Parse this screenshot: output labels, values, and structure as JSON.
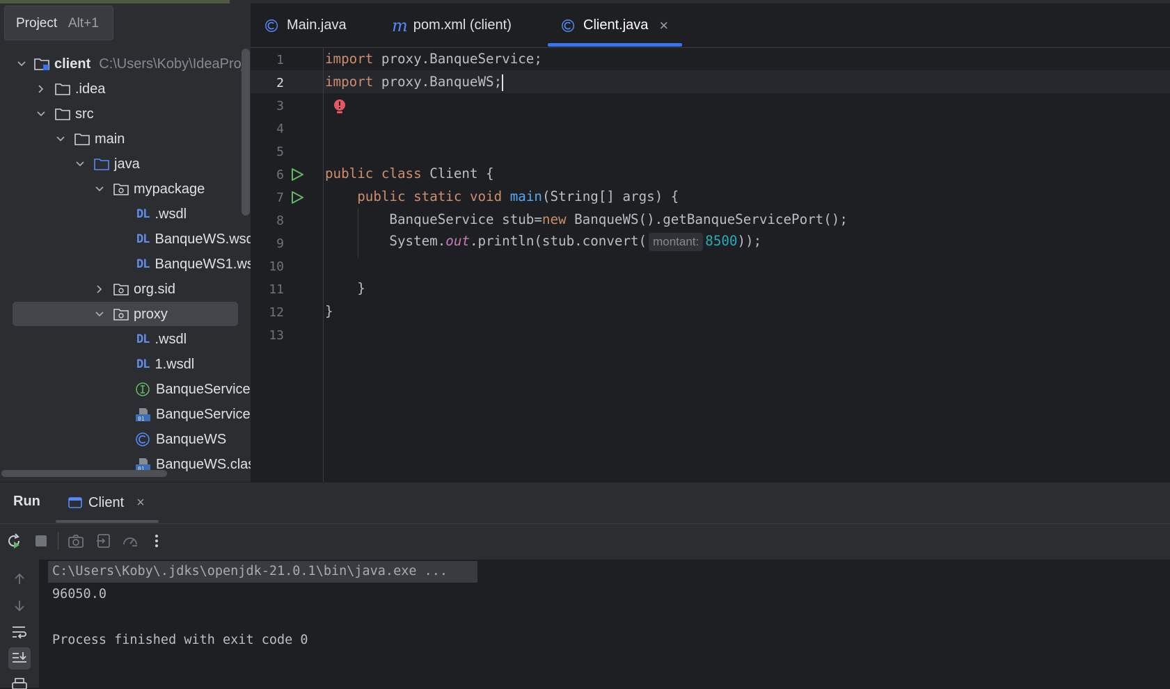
{
  "project_panel": {
    "title": "Project",
    "shortcut": "Alt+1",
    "tree": [
      {
        "label": "client",
        "path": "C:\\Users\\Koby\\IdeaProj",
        "type": "module",
        "chevron": "down"
      },
      {
        "label": ".idea",
        "type": "folder",
        "chevron": "right"
      },
      {
        "label": "src",
        "type": "folder",
        "chevron": "down"
      },
      {
        "label": "main",
        "type": "folder",
        "chevron": "down"
      },
      {
        "label": "java",
        "type": "source-folder",
        "chevron": "down"
      },
      {
        "label": "mypackage",
        "type": "package",
        "chevron": "down"
      },
      {
        "label": ".wsdl",
        "type": "wsdl"
      },
      {
        "label": "BanqueWS.wsd",
        "type": "wsdl"
      },
      {
        "label": "BanqueWS1.ws",
        "type": "wsdl"
      },
      {
        "label": "org.sid",
        "type": "package",
        "chevron": "right"
      },
      {
        "label": "proxy",
        "type": "package",
        "chevron": "down",
        "selected": true
      },
      {
        "label": ".wsdl",
        "type": "wsdl"
      },
      {
        "label": "1.wsdl",
        "type": "wsdl"
      },
      {
        "label": "BanqueService",
        "type": "interface"
      },
      {
        "label": "BanqueService",
        "type": "classfile"
      },
      {
        "label": "BanqueWS",
        "type": "class"
      },
      {
        "label": "BanqueWS.clas",
        "type": "classfile"
      }
    ]
  },
  "editor_tabs": [
    {
      "label": "Main.java",
      "icon": "class-icon",
      "active": false
    },
    {
      "label": "pom.xml (client)",
      "icon": "maven-icon",
      "active": false
    },
    {
      "label": "Client.java",
      "icon": "class-icon",
      "active": true,
      "close": "×"
    }
  ],
  "code": {
    "line_numbers": [
      "1",
      "2",
      "3",
      "4",
      "5",
      "6",
      "7",
      "8",
      "9",
      "10",
      "11",
      "12",
      "13"
    ],
    "current_line": "2",
    "l1": {
      "kw": "import",
      "rest": " proxy.BanqueService;"
    },
    "l2": {
      "kw": "import",
      "rest": " proxy.BanqueWS;"
    },
    "l6": {
      "kw1": "public",
      "kw2": "class",
      "rest": " Client {"
    },
    "l7": {
      "kw1": "public",
      "kw2": "static",
      "kw3": "void",
      "fn": "main",
      "rest": "(String[] args) {"
    },
    "l8": {
      "a": "BanqueService stub=",
      "kw": "new",
      "b": " BanqueWS().getBanqueServicePort();"
    },
    "l9": {
      "a": "System.",
      "it": "out",
      "b": ".println(stub.convert(",
      "hint": "montant:",
      "num": "8500",
      "c": "));"
    },
    "l11": "}",
    "l12": "}"
  },
  "run_panel": {
    "title": "Run",
    "tab_label": "Client",
    "tab_close": "×",
    "console": {
      "command": "C:\\Users\\Koby\\.jdks\\openjdk-21.0.1\\bin\\java.exe ...",
      "output": "96050.0",
      "status": "Process finished with exit code 0"
    }
  },
  "colors": {
    "keyword": "#cf8e6d",
    "function": "#56a8f5",
    "number": "#2aacb8",
    "static_field": "#c77dbb",
    "accent": "#3574f0",
    "run_green": "#5fb865",
    "error_red": "#e55765"
  }
}
